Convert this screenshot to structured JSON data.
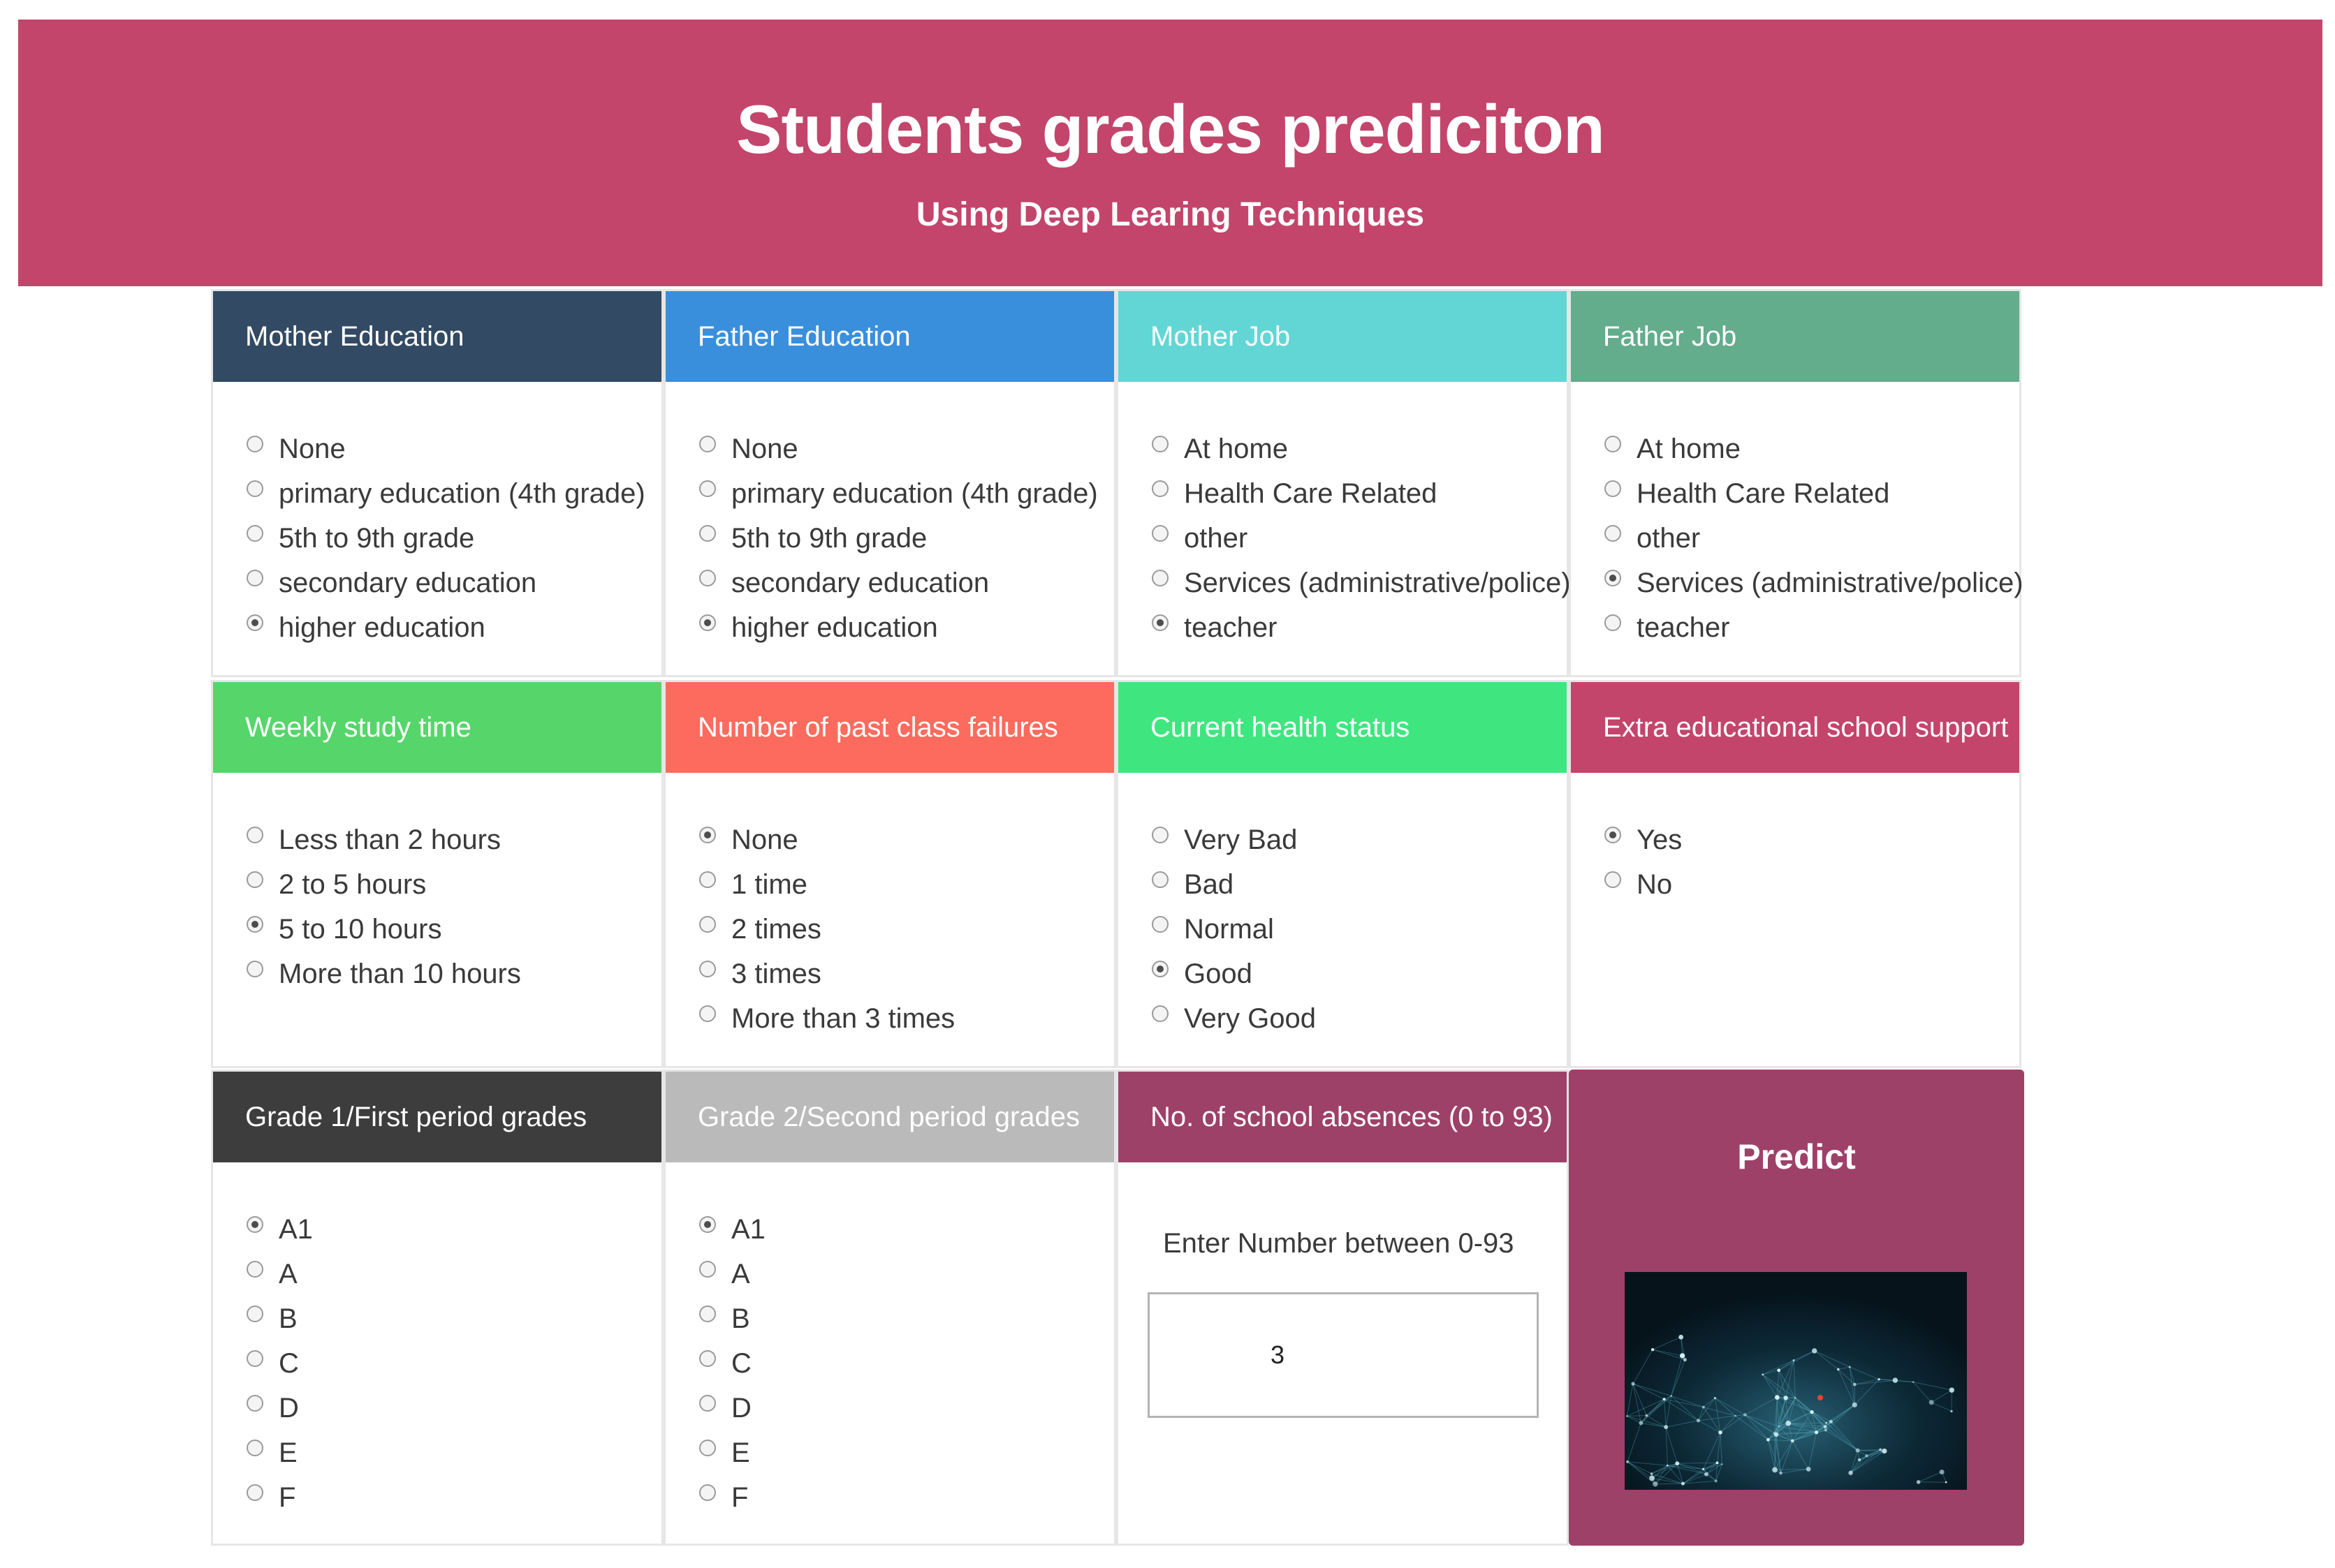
{
  "header": {
    "title": "Students grades prediciton",
    "subtitle": "Using Deep Learing Techniques"
  },
  "colors": {
    "header_bg": "#c3456c",
    "mother_education": "#324a63",
    "father_education": "#3a8fdc",
    "mother_job": "#62d6d5",
    "father_job": "#63ac8c",
    "weekly_study_time": "#56d66a",
    "past_failures": "#fc6b5d",
    "health_status": "#3fe680",
    "school_support": "#c3456c",
    "grade1": "#3d3d3d",
    "grade2": "#bababa",
    "absences": "#9e4169",
    "predict_bg": "#9e4169"
  },
  "cards": {
    "mother_education": {
      "title": "Mother Education",
      "options": [
        {
          "label": "None",
          "selected": false
        },
        {
          "label": "primary education (4th grade)",
          "selected": false
        },
        {
          "label": "5th to 9th grade",
          "selected": false
        },
        {
          "label": "secondary education",
          "selected": false
        },
        {
          "label": "higher education",
          "selected": true
        }
      ]
    },
    "father_education": {
      "title": "Father Education",
      "options": [
        {
          "label": "None",
          "selected": false
        },
        {
          "label": "primary education (4th grade)",
          "selected": false
        },
        {
          "label": "5th to 9th grade",
          "selected": false
        },
        {
          "label": "secondary education",
          "selected": false
        },
        {
          "label": "higher education",
          "selected": true
        }
      ]
    },
    "mother_job": {
      "title": "Mother Job",
      "options": [
        {
          "label": "At home",
          "selected": false
        },
        {
          "label": "Health Care Related",
          "selected": false
        },
        {
          "label": "other",
          "selected": false
        },
        {
          "label": "Services (administrative/police)",
          "selected": false
        },
        {
          "label": "teacher",
          "selected": true
        }
      ]
    },
    "father_job": {
      "title": "Father Job",
      "options": [
        {
          "label": "At home",
          "selected": false
        },
        {
          "label": "Health Care Related",
          "selected": false
        },
        {
          "label": "other",
          "selected": false
        },
        {
          "label": "Services (administrative/police)",
          "selected": true
        },
        {
          "label": "teacher",
          "selected": false
        }
      ]
    },
    "weekly_study_time": {
      "title": "Weekly study time",
      "options": [
        {
          "label": "Less than 2 hours",
          "selected": false
        },
        {
          "label": "2 to 5 hours",
          "selected": false
        },
        {
          "label": "5 to 10 hours",
          "selected": true
        },
        {
          "label": "More than 10 hours",
          "selected": false
        }
      ]
    },
    "past_failures": {
      "title": "Number of past class failures",
      "options": [
        {
          "label": "None",
          "selected": true
        },
        {
          "label": "1 time",
          "selected": false
        },
        {
          "label": "2 times",
          "selected": false
        },
        {
          "label": "3 times",
          "selected": false
        },
        {
          "label": "More than 3 times",
          "selected": false
        }
      ]
    },
    "health_status": {
      "title": "Current health status",
      "options": [
        {
          "label": "Very Bad",
          "selected": false
        },
        {
          "label": "Bad",
          "selected": false
        },
        {
          "label": "Normal",
          "selected": false
        },
        {
          "label": "Good",
          "selected": true
        },
        {
          "label": "Very Good",
          "selected": false
        }
      ]
    },
    "school_support": {
      "title": "Extra educational school support",
      "options": [
        {
          "label": "Yes",
          "selected": true
        },
        {
          "label": "No",
          "selected": false
        }
      ]
    },
    "grade1": {
      "title": "Grade 1/First period grades",
      "options": [
        {
          "label": "A1",
          "selected": true
        },
        {
          "label": "A",
          "selected": false
        },
        {
          "label": "B",
          "selected": false
        },
        {
          "label": "C",
          "selected": false
        },
        {
          "label": "D",
          "selected": false
        },
        {
          "label": "E",
          "selected": false
        },
        {
          "label": "F",
          "selected": false
        }
      ]
    },
    "grade2": {
      "title": "Grade 2/Second period grades",
      "options": [
        {
          "label": "A1",
          "selected": true
        },
        {
          "label": "A",
          "selected": false
        },
        {
          "label": "B",
          "selected": false
        },
        {
          "label": "C",
          "selected": false
        },
        {
          "label": "D",
          "selected": false
        },
        {
          "label": "E",
          "selected": false
        },
        {
          "label": "F",
          "selected": false
        }
      ]
    },
    "absences": {
      "title": "No. of school absences (0 to 93)",
      "prompt": "Enter Number between 0-93",
      "value": "3"
    }
  },
  "predict": {
    "label": "Predict",
    "image": "network-visualization-image"
  }
}
